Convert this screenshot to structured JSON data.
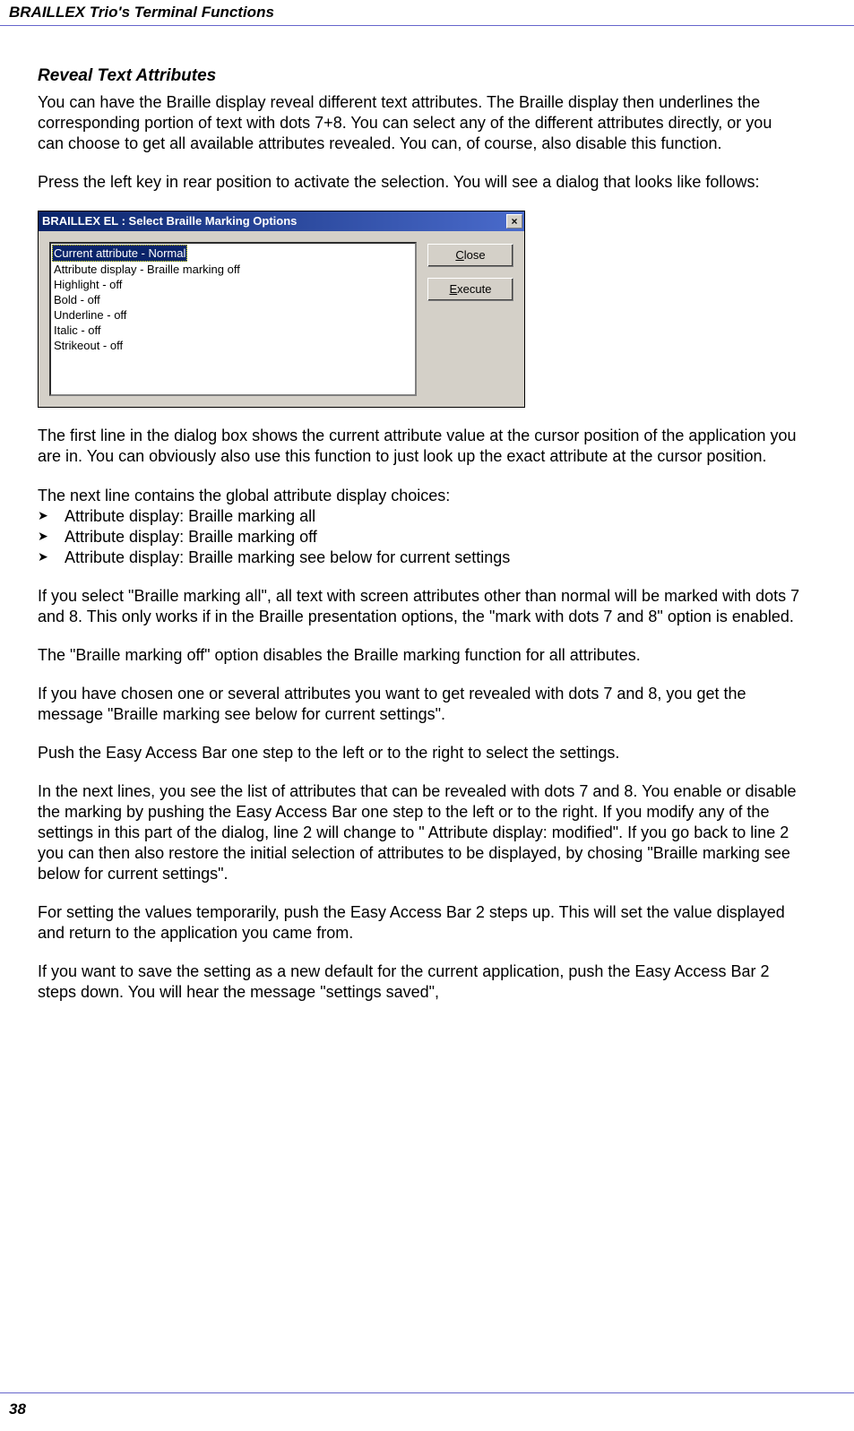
{
  "header": "BRAILLEX Trio's Terminal Functions",
  "section_title": "Reveal Text Attributes",
  "p1": "You can have the Braille display reveal different text attributes. The Braille display then underlines the corresponding portion of text with dots 7+8. You can select any of the different attributes directly, or you can choose to get all available attributes revealed. You can, of course, also disable this function.",
  "p2": "Press the left key in rear position to activate the selection. You will see a dialog that looks like follows:",
  "dialog": {
    "title": "BRAILLEX EL : Select Braille Marking Options",
    "close": "×",
    "items": [
      "Current attribute - Normal",
      "Attribute display - Braille marking off",
      "Highlight - off",
      "Bold - off",
      "Underline - off",
      "Italic - off",
      "Strikeout - off"
    ],
    "close_btn_u": "C",
    "close_btn_rest": "lose",
    "exec_btn_u": "E",
    "exec_btn_rest": "xecute"
  },
  "p3": "The first line in the dialog box shows the current attribute value at the cursor position of the application you are in. You can obviously also use this function to just look up the exact attribute at the cursor position.",
  "p4": "The next line contains the global attribute display choices:",
  "bullets": [
    "Attribute display: Braille marking all",
    "Attribute display: Braille marking off",
    "Attribute display: Braille marking see below for current settings"
  ],
  "p5": "If you select \"Braille marking all\", all text with screen attributes other than normal will be marked with dots 7 and 8. This only works if in the Braille presentation options, the \"mark with dots 7 and 8\" option is enabled.",
  "p6": "The \"Braille marking off\" option disables the Braille marking function for all attributes.",
  "p7": "If you have chosen one or several attributes you want to get revealed with dots 7 and 8, you get the message \"Braille marking see below for current settings\".",
  "p8": "Push the Easy Access Bar one step to the left or to the right to select the settings.",
  "p9": "In the next lines, you see the list of attributes that can be revealed with dots 7 and 8. You enable or disable the marking by pushing the Easy Access Bar one step to the left or to the right. If you modify any of the settings in this part of the dialog, line 2 will change to \" Attribute display: modified\". If you go back to line 2 you can then also restore the initial selection of attributes to be displayed, by chosing \"Braille marking see below for current settings\".",
  "p10": "For setting the values temporarily, push the Easy Access Bar 2 steps up. This will set the value displayed and return to the application you came from.",
  "p11": "If you want to save the setting as a new default for the current application, push the Easy Access Bar 2 steps down. You will hear the message \"settings saved\",",
  "page_number": "38"
}
